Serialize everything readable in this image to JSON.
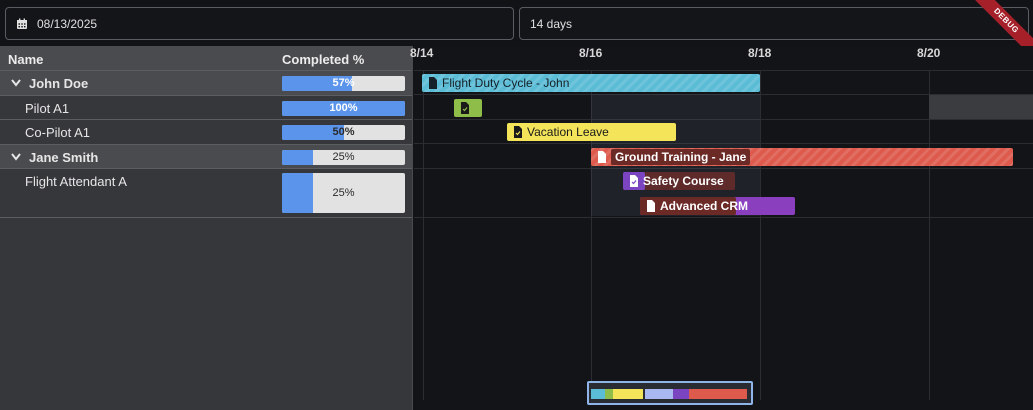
{
  "toolbar": {
    "date_value": "08/13/2025",
    "range_value": "14 days",
    "debug_label": "DEBUG"
  },
  "grid": {
    "col_name": "Name",
    "col_completed": "Completed %",
    "rows": [
      {
        "name": "John Doe",
        "percent": 57,
        "percent_label": "57%",
        "type": "group"
      },
      {
        "name": "Pilot A1",
        "percent": 100,
        "percent_label": "100%",
        "type": "child"
      },
      {
        "name": "Co-Pilot A1",
        "percent": 50,
        "percent_label": "50%",
        "type": "child"
      },
      {
        "name": "Jane Smith",
        "percent": 25,
        "percent_label": "25%",
        "type": "group"
      },
      {
        "name": "Flight Attendant A",
        "percent": 25,
        "percent_label": "25%",
        "type": "child"
      }
    ]
  },
  "timeline": {
    "ticks": [
      "8/14",
      "8/16",
      "8/18",
      "8/20"
    ],
    "tasks": [
      {
        "label": "Flight Duty Cycle - John",
        "color": "#5bbcd6"
      },
      {
        "label": "",
        "color": "#8fbd4a"
      },
      {
        "label": "Vacation Leave",
        "color": "#f3e45a"
      },
      {
        "label": "Ground Training - Jane",
        "color": "#dd5a4d"
      },
      {
        "label": "Safety Course",
        "color": "#7b45c2"
      },
      {
        "label": "Advanced CRM",
        "color": "#8a3fbf"
      }
    ]
  },
  "colors": {
    "progress_fill": "#5b95eb",
    "accent": "#8fb4e8"
  }
}
